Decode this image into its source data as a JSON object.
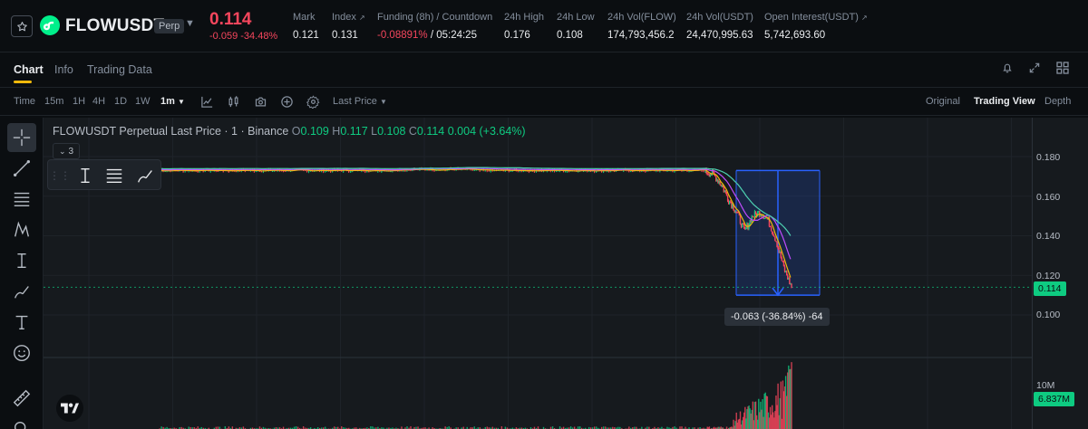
{
  "header": {
    "symbol": "FLOWUSDT",
    "badge": "Perp",
    "last_price": "0.114",
    "change": "-0.059  -34.48%",
    "stats": [
      {
        "label": "Mark",
        "value": "0.121"
      },
      {
        "label": "Index",
        "value": "0.131"
      },
      {
        "label": "Funding (8h) / Countdown",
        "value_a": "-0.08891%",
        "value_b": " / 05:24:25"
      },
      {
        "label": "24h High",
        "value": "0.176"
      },
      {
        "label": "24h Low",
        "value": "0.108"
      },
      {
        "label": "24h Vol(FLOW)",
        "value": "174,793,456.2"
      },
      {
        "label": "24h Vol(USDT)",
        "value": "24,470,995.63"
      },
      {
        "label": "Open Interest(USDT)",
        "value": "5,742,693.60"
      }
    ]
  },
  "tabs": [
    {
      "label": "Chart",
      "active": true
    },
    {
      "label": "Info",
      "active": false
    },
    {
      "label": "Trading Data",
      "active": false
    }
  ],
  "toolbar": {
    "time_label": "Time",
    "intervals": [
      "15m",
      "1H",
      "4H",
      "1D",
      "1W"
    ],
    "selected_interval": "1m",
    "price_type": "Last Price",
    "views": [
      "Original",
      "Trading View",
      "Depth"
    ],
    "active_view": "Trading View"
  },
  "legend": {
    "title": "FLOWUSDT Perpetual Last Price · 1 · Binance",
    "o_key": "O",
    "o_val": "0.109",
    "h_key": "H",
    "h_val": "0.117",
    "l_key": "L",
    "l_val": "0.108",
    "c_key": "C",
    "c_val": "0.114",
    "change": "0.004 (+3.64%)",
    "indicator_count": "3"
  },
  "price_axis": {
    "ticks": [
      "0.180",
      "0.160",
      "0.140",
      "0.120",
      "0.100",
      "10M"
    ],
    "current_price_tag": "0.114",
    "volume_tag": "6.837M"
  },
  "measure_tooltip": "-0.063 (-36.84%) -64",
  "chart_data": {
    "type": "line",
    "ylim": [
      0.095,
      0.185
    ],
    "series": [
      {
        "values": [
          0.173,
          0.173,
          0.173,
          0.1735,
          0.173,
          0.173,
          0.173,
          0.1725,
          0.171,
          0.166,
          0.158,
          0.152,
          0.142,
          0.15,
          0.152,
          0.148,
          0.138,
          0.124,
          0.114
        ]
      }
    ]
  },
  "colors": {
    "up": "#0ecb81",
    "down": "#f6465d",
    "accent": "#f0b90b",
    "measure_box": "#2962ff"
  }
}
